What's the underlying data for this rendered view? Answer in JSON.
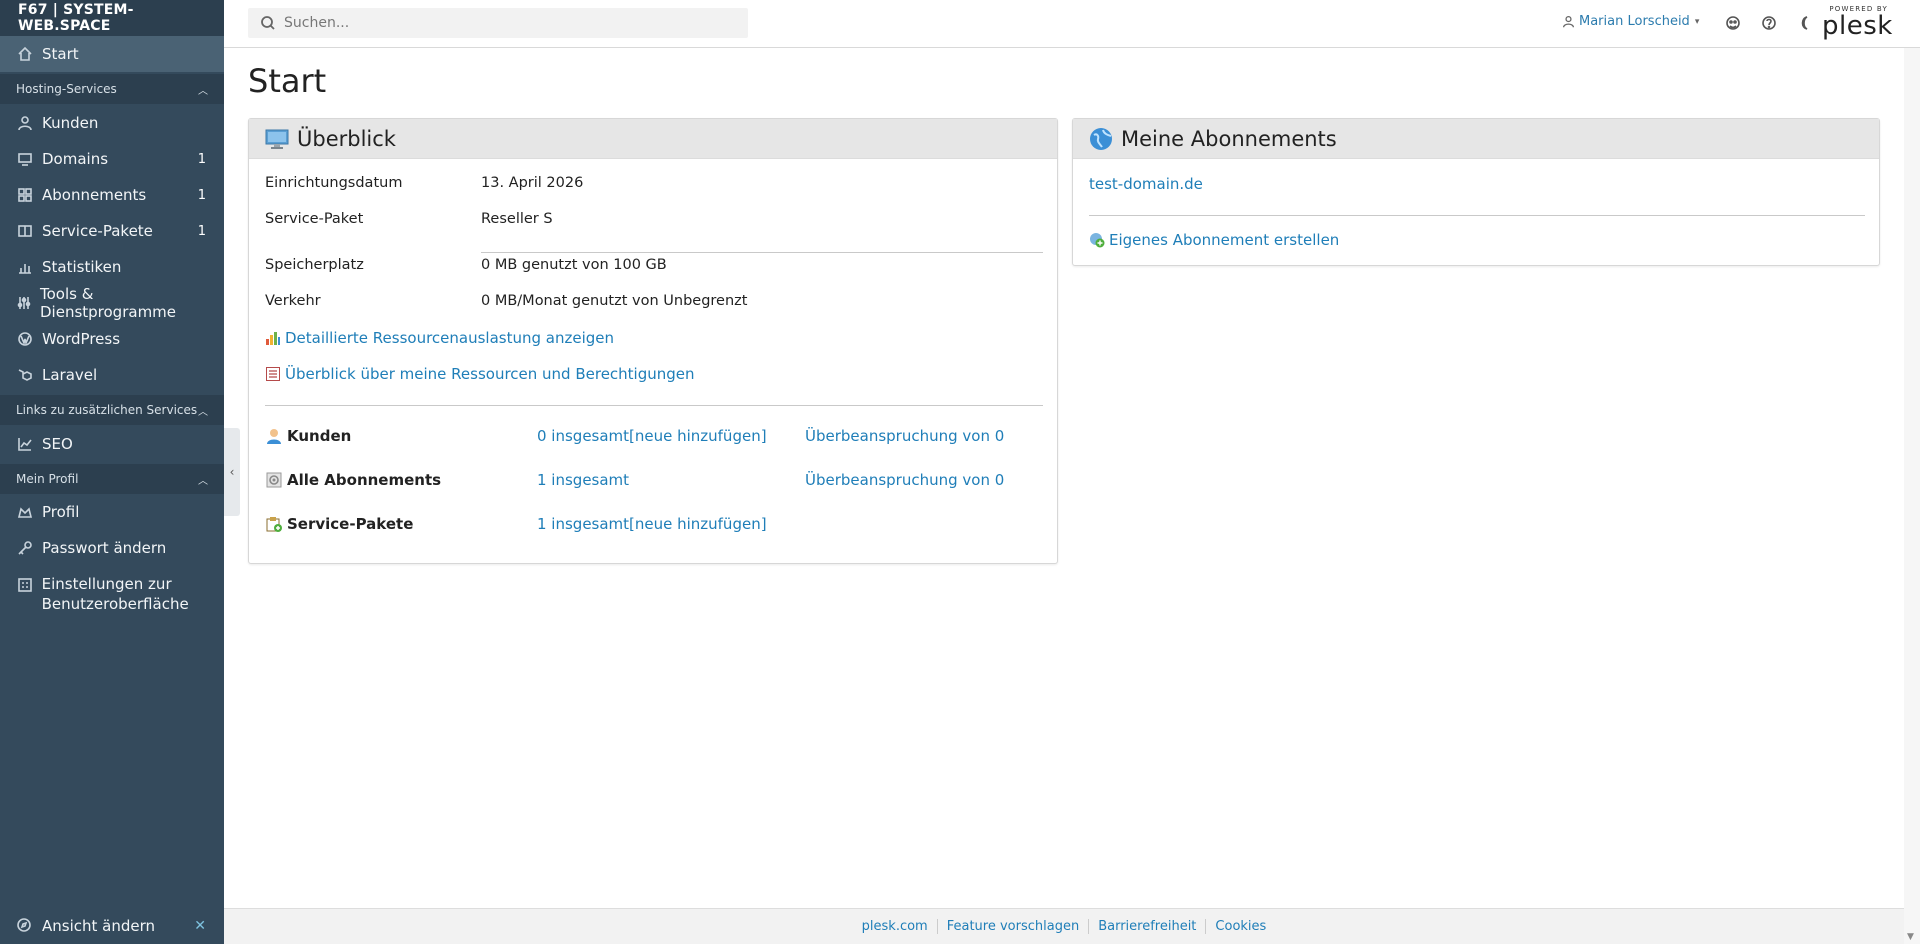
{
  "sidebar": {
    "brand": "F67 | SYSTEM-WEB.SPACE",
    "start": "Start",
    "sections": {
      "hosting": "Hosting-Services",
      "links": "Links zu zusätzlichen Services",
      "profile": "Mein Profil"
    },
    "hosting_items": [
      {
        "label": "Kunden",
        "count": ""
      },
      {
        "label": "Domains",
        "count": "1"
      },
      {
        "label": "Abonnements",
        "count": "1"
      },
      {
        "label": "Service-Pakete",
        "count": "1"
      },
      {
        "label": "Statistiken",
        "count": ""
      },
      {
        "label": "Tools & Dienstprogramme",
        "count": ""
      },
      {
        "label": "WordPress",
        "count": ""
      },
      {
        "label": "Laravel",
        "count": ""
      }
    ],
    "links_items": [
      {
        "label": "SEO"
      }
    ],
    "profile_items": [
      {
        "label": "Profil"
      },
      {
        "label": "Passwort ändern"
      },
      {
        "label": "Einstellungen zur Benutzeroberfläche"
      }
    ],
    "bottom": "Ansicht ändern"
  },
  "header": {
    "search_placeholder": "Suchen...",
    "user": "Marian Lorscheid",
    "powered_by": "POWERED BY",
    "logo": "plesk"
  },
  "page": {
    "title": "Start"
  },
  "overview": {
    "title": "Überblick",
    "rows": [
      {
        "key": "Einrichtungsdatum",
        "value": "13. April 2026"
      },
      {
        "key": "Service-Paket",
        "value": "Reseller S"
      },
      {
        "key": "Speicherplatz",
        "value": "0 MB genutzt von 100 GB"
      },
      {
        "key": "Verkehr",
        "value": "0 MB/Monat genutzt von Unbegrenzt"
      }
    ],
    "link_resources": "Detaillierte Ressourcenauslastung anzeigen",
    "link_permissions": "Überblick über meine Ressourcen und Berechtigungen",
    "stats": [
      {
        "label": "Kunden",
        "total": "0 insgesamt",
        "add": "[neue hinzufügen]",
        "over": "Überbeanspruchung von 0"
      },
      {
        "label": "Alle Abonnements",
        "total": "1 insgesamt",
        "add": "",
        "over": "Überbeanspruchung von 0"
      },
      {
        "label": "Service-Pakete",
        "total": "1 insgesamt",
        "add": "[neue hinzufügen]",
        "over": ""
      }
    ]
  },
  "subscriptions": {
    "title": "Meine Abonnements",
    "domain": "test-domain.de",
    "create": "Eigenes Abonnement erstellen"
  },
  "footer": {
    "links": [
      "plesk.com",
      "Feature vorschlagen",
      "Barrierefreiheit",
      "Cookies"
    ]
  },
  "colors": {
    "sidebar_bg": "#344a5c",
    "link": "#1f7eb8",
    "card_header": "#e6e6e6"
  }
}
